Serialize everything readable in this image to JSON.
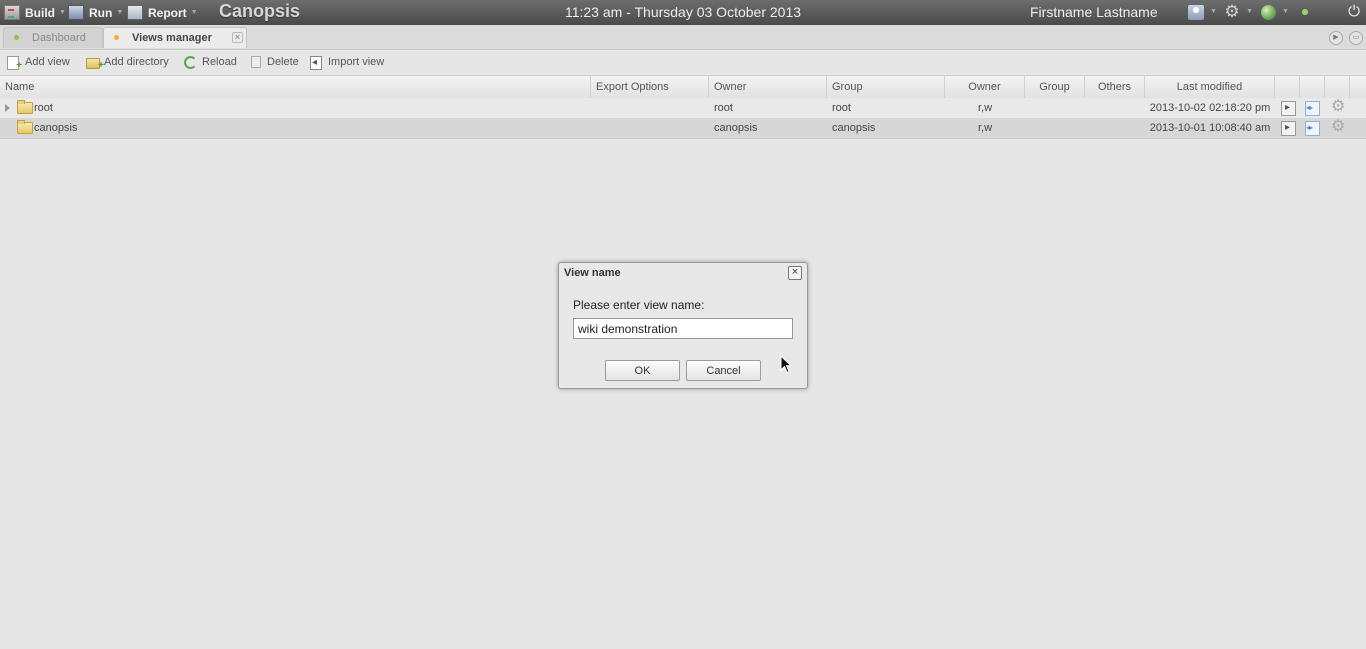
{
  "topbar": {
    "menus": [
      {
        "label": "Build",
        "icon": "build-icon"
      },
      {
        "label": "Run",
        "icon": "run-icon"
      },
      {
        "label": "Report",
        "icon": "report-icon"
      }
    ],
    "app_title": "Canopsis",
    "clock": "11:23 am - Thursday 03 October 2013",
    "user_name": "Firstname Lastname",
    "icons": [
      "avatar-icon",
      "gear-icon",
      "globe-icon",
      "status-dot-icon",
      "power-icon"
    ]
  },
  "tabs": [
    {
      "label": "Dashboard",
      "active": false
    },
    {
      "label": "Views manager",
      "active": true,
      "close": "×"
    }
  ],
  "toolbar": {
    "add_view": "Add view",
    "add_directory": "Add directory",
    "reload": "Reload",
    "delete": "Delete",
    "import_view": "Import view"
  },
  "grid": {
    "columns": [
      "Name",
      "Export Options",
      "Owner",
      "Group",
      "Owner",
      "Group",
      "Others",
      "Last modified"
    ],
    "rows": [
      {
        "name": "root",
        "export": "",
        "owner": "root",
        "group": "root",
        "perm_owner": "r,w",
        "perm_group": "",
        "perm_others": "",
        "last_modified": "2013-10-02 02:18:20 pm",
        "expandable": true
      },
      {
        "name": "canopsis",
        "export": "",
        "owner": "canopsis",
        "group": "canopsis",
        "perm_owner": "r,w",
        "perm_group": "",
        "perm_others": "",
        "last_modified": "2013-10-01 10:08:40 am",
        "expandable": false
      }
    ]
  },
  "dialog": {
    "title": "View name",
    "close": "×",
    "prompt": "Please enter view name:",
    "input_value": "wiki demonstration",
    "ok": "OK",
    "cancel": "Cancel"
  },
  "colors": {
    "topbar": "#5a5a5a",
    "background": "#e6e6e6",
    "selected_row": "#d7d7d7"
  }
}
